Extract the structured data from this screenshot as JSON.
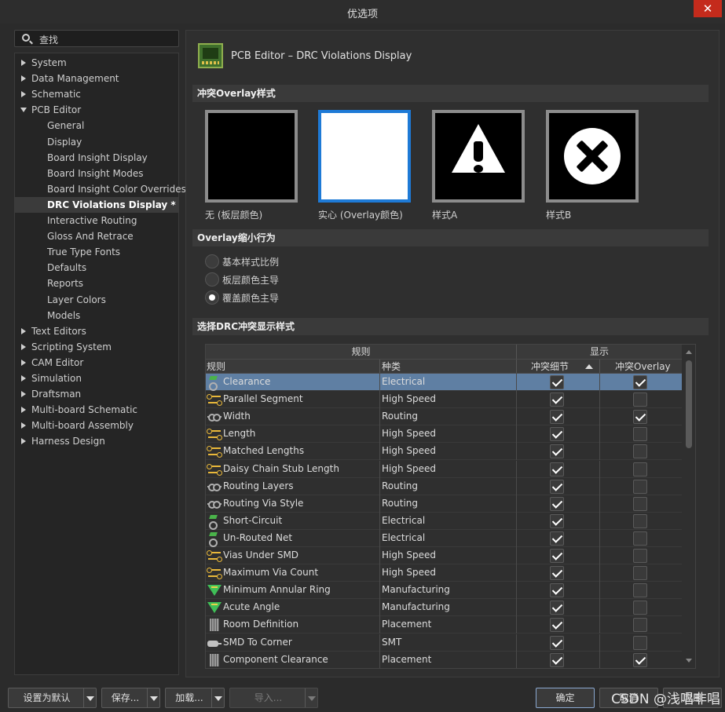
{
  "window": {
    "title": "优选项",
    "close": "✕"
  },
  "search": {
    "placeholder": "查找"
  },
  "tree": [
    {
      "label": "System",
      "level": 0,
      "arrow": "closed"
    },
    {
      "label": "Data Management",
      "level": 0,
      "arrow": "closed"
    },
    {
      "label": "Schematic",
      "level": 0,
      "arrow": "closed"
    },
    {
      "label": "PCB Editor",
      "level": 0,
      "arrow": "open"
    },
    {
      "label": "General",
      "level": 1
    },
    {
      "label": "Display",
      "level": 1
    },
    {
      "label": "Board Insight Display",
      "level": 1
    },
    {
      "label": "Board Insight Modes",
      "level": 1
    },
    {
      "label": "Board Insight Color Overrides",
      "level": 1
    },
    {
      "label": "DRC Violations Display *",
      "level": 1,
      "selected": true
    },
    {
      "label": "Interactive Routing",
      "level": 1
    },
    {
      "label": "Gloss And Retrace",
      "level": 1
    },
    {
      "label": "True Type Fonts",
      "level": 1
    },
    {
      "label": "Defaults",
      "level": 1
    },
    {
      "label": "Reports",
      "level": 1
    },
    {
      "label": "Layer Colors",
      "level": 1
    },
    {
      "label": "Models",
      "level": 1
    },
    {
      "label": "Text Editors",
      "level": 0,
      "arrow": "closed"
    },
    {
      "label": "Scripting System",
      "level": 0,
      "arrow": "closed"
    },
    {
      "label": "CAM Editor",
      "level": 0,
      "arrow": "closed"
    },
    {
      "label": "Simulation",
      "level": 0,
      "arrow": "closed"
    },
    {
      "label": "Draftsman",
      "level": 0,
      "arrow": "closed"
    },
    {
      "label": "Multi-board Schematic",
      "level": 0,
      "arrow": "closed"
    },
    {
      "label": "Multi-board Assembly",
      "level": 0,
      "arrow": "closed"
    },
    {
      "label": "Harness Design",
      "level": 0,
      "arrow": "closed"
    }
  ],
  "page": {
    "title": "PCB Editor – DRC Violations Display"
  },
  "sections": {
    "overlay_style": "冲突Overlay样式",
    "overlay_shrink": "Overlay缩小行为",
    "drc_display": "选择DRC冲突显示样式"
  },
  "overlay_styles": [
    {
      "label": "无 (板层颜色)",
      "selected": false
    },
    {
      "label": "实心 (Overlay颜色)",
      "selected": true
    },
    {
      "label": "样式A",
      "selected": false
    },
    {
      "label": "样式B",
      "selected": false
    }
  ],
  "shrink_options": [
    {
      "label": "基本样式比例",
      "checked": false
    },
    {
      "label": "板层颜色主导",
      "checked": false
    },
    {
      "label": "覆盖颜色主导",
      "checked": true
    }
  ],
  "grid": {
    "group_rules": "规则",
    "group_display": "显示",
    "col_rule": "规则",
    "col_type": "种类",
    "col_detail": "冲突细节",
    "col_overlay": "冲突Overlay",
    "rows": [
      {
        "name": "Clearance",
        "type": "Electrical",
        "icon": "elec",
        "detail": true,
        "overlay": true,
        "selected": true
      },
      {
        "name": "Parallel Segment",
        "type": "High Speed",
        "icon": "conn",
        "detail": true,
        "overlay": false
      },
      {
        "name": "Width",
        "type": "Routing",
        "icon": "route",
        "detail": true,
        "overlay": true
      },
      {
        "name": "Length",
        "type": "High Speed",
        "icon": "conn",
        "detail": true,
        "overlay": false
      },
      {
        "name": "Matched Lengths",
        "type": "High Speed",
        "icon": "conn",
        "detail": true,
        "overlay": false
      },
      {
        "name": "Daisy Chain Stub Length",
        "type": "High Speed",
        "icon": "conn",
        "detail": true,
        "overlay": false
      },
      {
        "name": "Routing Layers",
        "type": "Routing",
        "icon": "route",
        "detail": true,
        "overlay": false
      },
      {
        "name": "Routing Via Style",
        "type": "Routing",
        "icon": "route",
        "detail": true,
        "overlay": false
      },
      {
        "name": "Short-Circuit",
        "type": "Electrical",
        "icon": "elec",
        "detail": true,
        "overlay": false
      },
      {
        "name": "Un-Routed Net",
        "type": "Electrical",
        "icon": "elec",
        "detail": true,
        "overlay": false
      },
      {
        "name": "Vias Under SMD",
        "type": "High Speed",
        "icon": "conn",
        "detail": true,
        "overlay": false
      },
      {
        "name": "Maximum Via Count",
        "type": "High Speed",
        "icon": "conn",
        "detail": true,
        "overlay": false
      },
      {
        "name": "Minimum Annular Ring",
        "type": "Manufacturing",
        "icon": "mfg",
        "detail": true,
        "overlay": false
      },
      {
        "name": "Acute Angle",
        "type": "Manufacturing",
        "icon": "mfg",
        "detail": true,
        "overlay": false
      },
      {
        "name": "Room Definition",
        "type": "Placement",
        "icon": "place",
        "detail": true,
        "overlay": false
      },
      {
        "name": "SMD To Corner",
        "type": "SMT",
        "icon": "smt",
        "detail": true,
        "overlay": false
      },
      {
        "name": "Component Clearance",
        "type": "Placement",
        "icon": "place",
        "detail": true,
        "overlay": true
      }
    ]
  },
  "buttons": {
    "reset": "设置为默认",
    "save": "保存...",
    "load": "加载...",
    "import": "导入...",
    "ok": "确定",
    "cancel": "取消",
    "apply": "应用"
  },
  "watermark": "CSDN @浅唱非唱"
}
